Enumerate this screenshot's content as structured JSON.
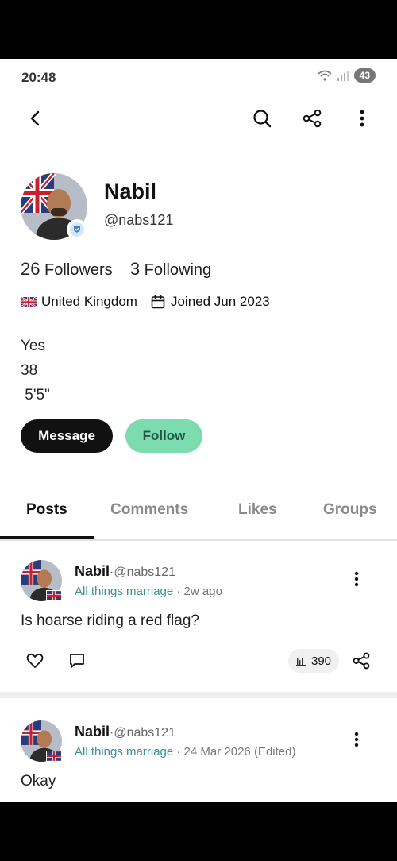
{
  "status": {
    "time": "20:48",
    "battery": "43"
  },
  "profile": {
    "name": "Nabil",
    "handle": "@nabs121",
    "followers_count": "26",
    "followers_label": "Followers",
    "following_count": "3",
    "following_label": "Following",
    "location": "United Kingdom",
    "joined": "Joined Jun 2023",
    "bio": [
      "Yes",
      "38",
      " 5'5\""
    ]
  },
  "buttons": {
    "message": "Message",
    "follow": "Follow"
  },
  "tabs": [
    "Posts",
    "Comments",
    "Likes",
    "Groups"
  ],
  "posts": [
    {
      "name": "Nabil",
      "handle": "·@nabs121",
      "group": "All things marriage",
      "time": " · 2w ago",
      "text": "Is hoarse riding a red flag?",
      "views": "390"
    },
    {
      "name": "Nabil",
      "handle": "·@nabs121",
      "group": "All things marriage",
      "time": " · 24 Mar 2026 (Edited)",
      "text": "Okay",
      "views": ""
    }
  ],
  "colors": {
    "follow_bg": "#7ddbb0",
    "group_link": "#3a8f9a"
  },
  "icons": [
    "back-icon",
    "search-icon",
    "share-icon",
    "more-vertical-icon",
    "uk-flag-icon",
    "calendar-icon",
    "heart-icon",
    "comment-icon",
    "bar-chart-icon",
    "verified-badge-icon"
  ]
}
